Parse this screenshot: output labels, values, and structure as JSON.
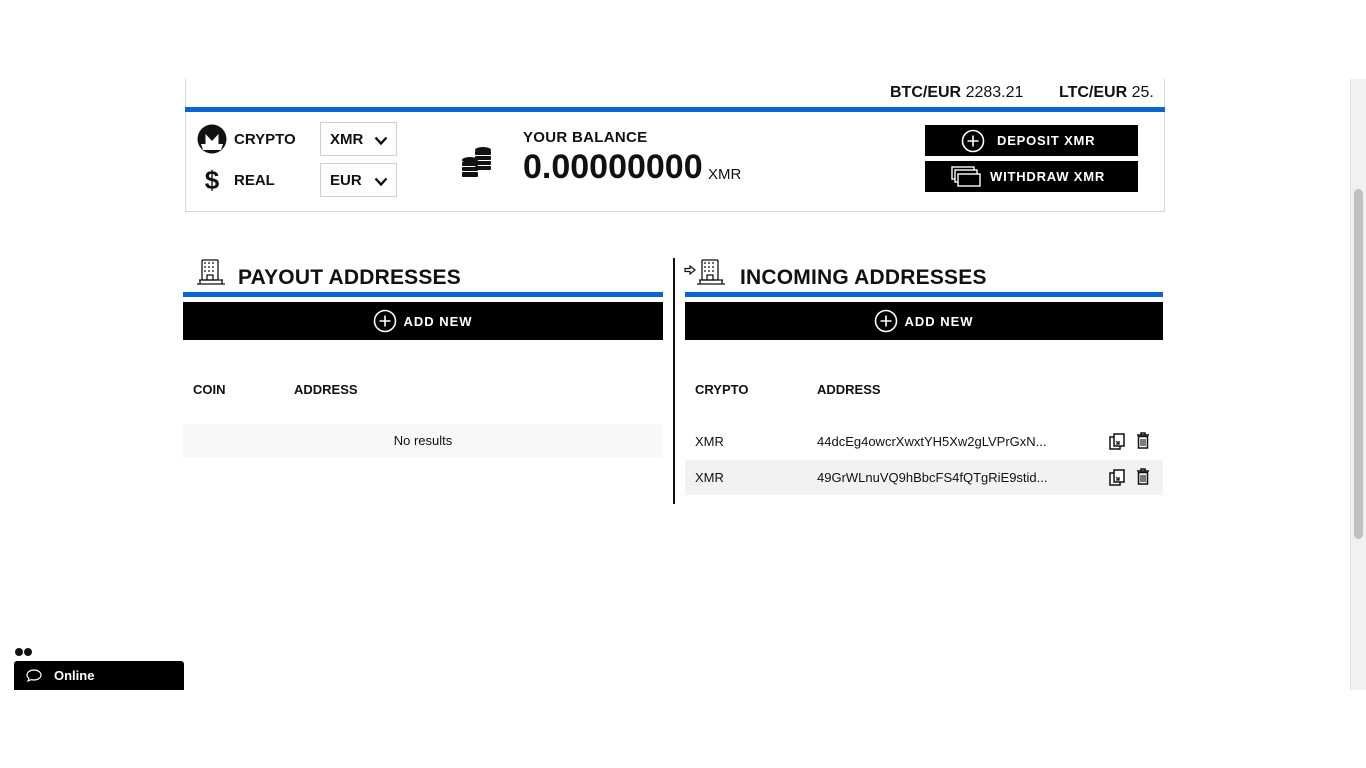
{
  "ticker": [
    {
      "pair": "BTC/EUR",
      "value": "2283.21"
    },
    {
      "pair": "LTC/EUR",
      "value": "25."
    }
  ],
  "currency": {
    "crypto_label": "CRYPTO",
    "crypto_selected": "XMR",
    "real_label": "REAL",
    "real_selected": "EUR",
    "real_symbol": "$"
  },
  "balance": {
    "label": "YOUR BALANCE",
    "value": "0.00000000",
    "unit": "XMR"
  },
  "actions": {
    "deposit": "DEPOSIT XMR",
    "withdraw": "WITHDRAW XMR"
  },
  "payout": {
    "title": "PAYOUT ADDRESSES",
    "add_new": "ADD NEW",
    "columns": [
      "COIN",
      "ADDRESS"
    ],
    "empty": "No results"
  },
  "incoming": {
    "title": "INCOMING ADDRESSES",
    "add_new": "ADD NEW",
    "columns": [
      "CRYPTO",
      "ADDRESS"
    ],
    "rows": [
      {
        "coin": "XMR",
        "address": "44dcEg4owcrXwxtYH5Xw2gLVPrGxN..."
      },
      {
        "coin": "XMR",
        "address": "49GrWLnuVQ9hBbcFS4fQTgRiE9stid..."
      }
    ]
  },
  "chat": {
    "status": "Online"
  },
  "colors": {
    "accent": "#0a64d2",
    "button": "#000000",
    "row_alt": "#f2f2f2"
  }
}
